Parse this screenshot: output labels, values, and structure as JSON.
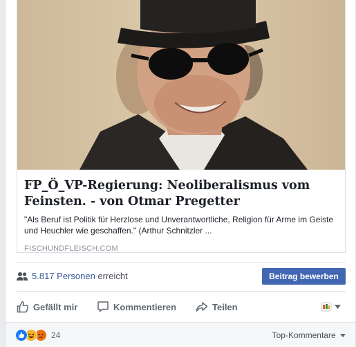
{
  "post": {
    "link": {
      "title": "FP_Ö_VP-Regierung: Neoliberalismus vom Feinsten. - von Otmar Pregetter",
      "description": "\"Als Beruf ist Politik für Herzlose und Unverantwortliche, Religion für Arme im Geiste und Heuchler wie geschaffen.\" (Arthur Schnitzler ...",
      "domain": "FISCHUNDFLEISCH.COM"
    },
    "reach": {
      "count": "5.817 Personen",
      "suffix": "erreicht",
      "promote_label": "Beitrag bewerben"
    },
    "actions": {
      "like": "Gefällt mir",
      "comment": "Kommentieren",
      "share": "Teilen"
    },
    "reactions": {
      "count": "24",
      "sort_label": "Top-Kommentare"
    }
  },
  "colors": {
    "link_blue": "#365899",
    "button_blue": "#4267b2",
    "like_blue": "#1877f2",
    "haha_yellow": "#f7b125",
    "angry_orange": "#e9710f"
  },
  "icons": [
    "reach-people-icon",
    "like-icon",
    "comment-icon",
    "share-icon",
    "page-avatar-icon",
    "caret-down-icon",
    "like-reaction-icon",
    "haha-reaction-icon",
    "angry-reaction-icon"
  ]
}
